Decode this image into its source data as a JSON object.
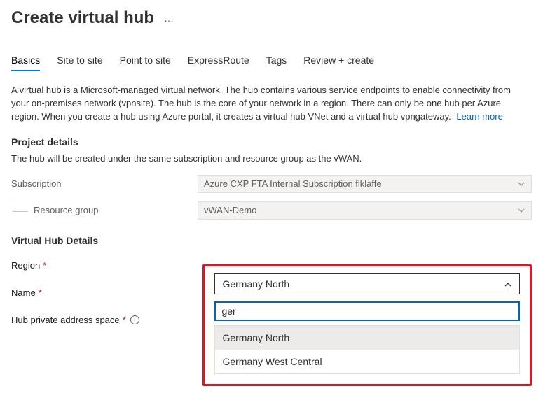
{
  "page_title": "Create virtual hub",
  "tabs": [
    "Basics",
    "Site to site",
    "Point to site",
    "ExpressRoute",
    "Tags",
    "Review + create"
  ],
  "active_tab": 0,
  "description": "A virtual hub is a Microsoft-managed virtual network. The hub contains various service endpoints to enable connectivity from your on-premises network (vpnsite). The hub is the core of your network in a region. There can only be one hub per Azure region. When you create a hub using Azure portal, it creates a virtual hub VNet and a virtual hub vpngateway.",
  "learn_more": "Learn more",
  "project_details": {
    "title": "Project details",
    "sub": "The hub will be created under the same subscription and resource group as the vWAN.",
    "subscription_label": "Subscription",
    "subscription_value": "Azure CXP FTA Internal Subscription flklaffe",
    "resource_group_label": "Resource group",
    "resource_group_value": "vWAN-Demo"
  },
  "virtual_hub": {
    "title": "Virtual Hub Details",
    "region_label": "Region",
    "name_label": "Name",
    "addr_label": "Hub private address space",
    "region_selected": "Germany North",
    "search_value": "ger",
    "options": [
      "Germany North",
      "Germany West Central"
    ],
    "focused_index": 0
  }
}
